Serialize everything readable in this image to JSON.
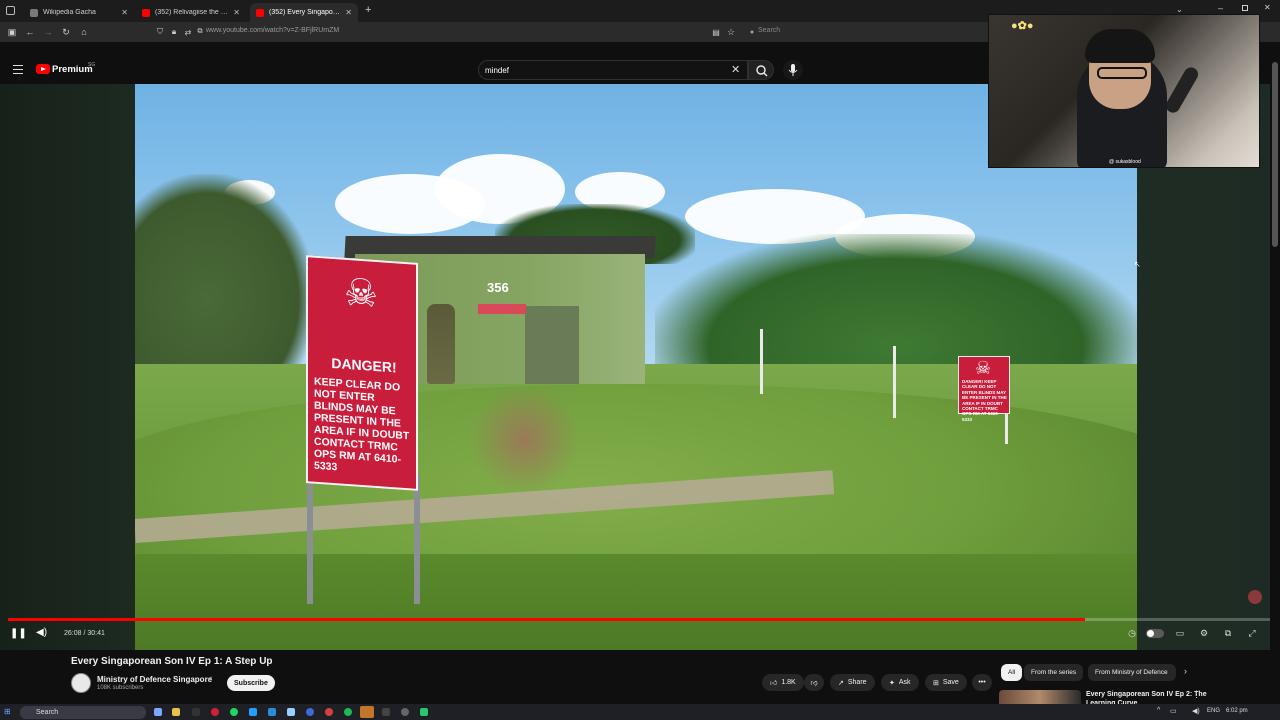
{
  "browser": {
    "tabs": [
      {
        "label": "Wikipedia Gacha",
        "favicon_color": "#7a7a7a"
      },
      {
        "label": "(352) Relivagiise the flight -",
        "favicon_color": "#ff0000"
      },
      {
        "label": "(352) Every Singaporean So",
        "favicon_color": "#ff0000"
      }
    ],
    "url": "www.youtube.com/watch?v=Z-BFjlRUmZM",
    "search_placeholder": "Search"
  },
  "youtube": {
    "brand": "Premium",
    "region": "SG",
    "search_value": "mindef"
  },
  "video": {
    "bunker_number": "356",
    "sign": {
      "heading": "DANGER!",
      "body": "KEEP CLEAR DO NOT ENTER BLINDS MAY BE PRESENT IN THE AREA IF IN DOUBT CONTACT TRMC OPS RM AT 6410-5333"
    },
    "small_sign": {
      "heading": "DANGER!",
      "body": "KEEP CLEAR DO NOT ENTER BLINDS MAY BE PRESENT IN THE AREA IF IN DOUBT CONTACT TRMC OPS RM AT 6410-5333"
    },
    "webcam_handle": "@ sukasblood",
    "time": "26:08 / 30:41",
    "progress_fraction": 0.852
  },
  "details": {
    "title": "Every Singaporean Son IV Ep 1: A Step Up",
    "channel": "Ministry of Defence Singapore",
    "subscribers": "108K subscribers",
    "subscribe_label": "Subscribe",
    "likes": "1.8K",
    "share_label": "Share",
    "ask_label": "Ask",
    "save_label": "Save"
  },
  "recommendations": {
    "chips": [
      "All",
      "From the series",
      "From Ministry of Defence"
    ],
    "first_title": "Every Singaporean Son IV Ep 2: The Learning Curve"
  },
  "taskbar": {
    "search_label": "Search",
    "language": "ENG",
    "time": "6:02 pm"
  },
  "colors": {
    "youtube_red": "#ff0000",
    "sign_red": "#c81e3c",
    "page_bg": "#0f0f0f"
  }
}
